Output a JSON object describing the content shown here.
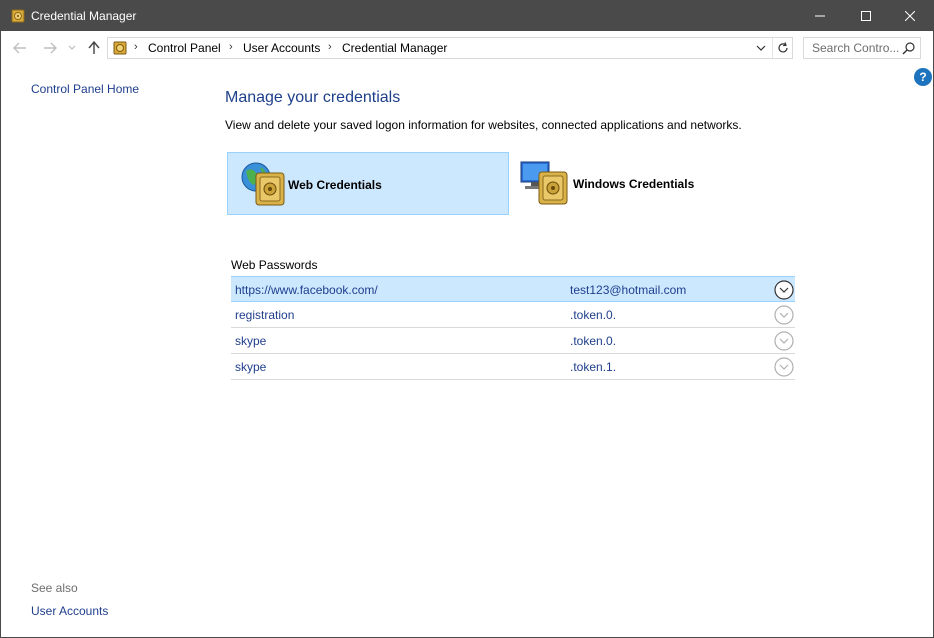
{
  "window": {
    "title": "Credential Manager"
  },
  "address": {
    "crumbs": [
      "Control Panel",
      "User Accounts",
      "Credential Manager"
    ],
    "search_placeholder": "Search Contro..."
  },
  "sidebar": {
    "home_link": "Control Panel Home",
    "see_also": "See also",
    "user_accounts_link": "User Accounts"
  },
  "main": {
    "title": "Manage your credentials",
    "description": "View and delete your saved logon information for websites, connected applications and networks.",
    "tiles": [
      {
        "label": "Web Credentials",
        "selected": true
      },
      {
        "label": "Windows Credentials",
        "selected": false
      }
    ],
    "section_label": "Web Passwords",
    "passwords": [
      {
        "site": "https://www.facebook.com/",
        "user": "test123@hotmail.com",
        "selected": true
      },
      {
        "site": "registration",
        "user": ".token.0.",
        "selected": false
      },
      {
        "site": "skype",
        "user": ".token.0.",
        "selected": false
      },
      {
        "site": "skype",
        "user": ".token.1.",
        "selected": false
      }
    ]
  },
  "icons": {
    "help": "?"
  },
  "colors": {
    "titlebar": "#4a4a4a",
    "link": "#1f3e8c",
    "selection": "#cce8ff",
    "selection_border": "#99d1ff",
    "heading": "#1e3f8a"
  }
}
